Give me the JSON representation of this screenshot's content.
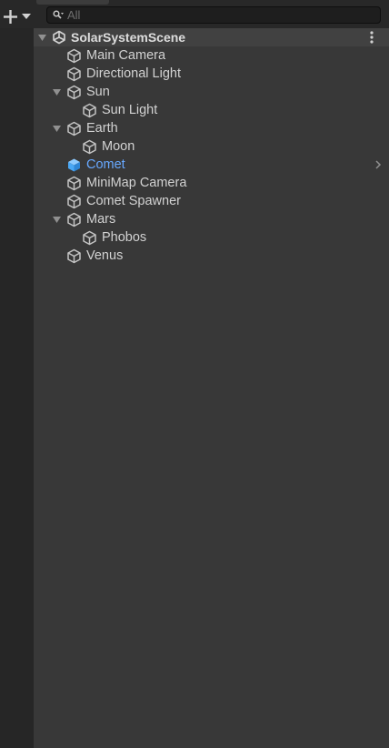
{
  "toolbar": {
    "add_icon": "plus-icon",
    "dropdown_icon": "triangle-down-icon"
  },
  "search": {
    "placeholder": "All",
    "value": "",
    "icon": "search-icon"
  },
  "scene": {
    "name": "SolarSystemScene",
    "icon": "unity-scene-icon",
    "menu_icon": "kebab-menu-icon",
    "expanded": true
  },
  "hierarchy": {
    "items": [
      {
        "label": "Main Camera",
        "depth": 0,
        "has_children": false,
        "expanded": false,
        "selected": false
      },
      {
        "label": "Directional Light",
        "depth": 0,
        "has_children": false,
        "expanded": false,
        "selected": false
      },
      {
        "label": "Sun",
        "depth": 0,
        "has_children": true,
        "expanded": true,
        "selected": false
      },
      {
        "label": "Sun Light",
        "depth": 1,
        "has_children": false,
        "expanded": false,
        "selected": false
      },
      {
        "label": "Earth",
        "depth": 0,
        "has_children": true,
        "expanded": true,
        "selected": false
      },
      {
        "label": "Moon",
        "depth": 1,
        "has_children": false,
        "expanded": false,
        "selected": false
      },
      {
        "label": "Comet",
        "depth": 0,
        "has_children": false,
        "expanded": false,
        "selected": true
      },
      {
        "label": "MiniMap Camera",
        "depth": 0,
        "has_children": false,
        "expanded": false,
        "selected": false
      },
      {
        "label": "Comet Spawner",
        "depth": 0,
        "has_children": false,
        "expanded": false,
        "selected": false
      },
      {
        "label": "Mars",
        "depth": 0,
        "has_children": true,
        "expanded": true,
        "selected": false
      },
      {
        "label": "Phobos",
        "depth": 1,
        "has_children": false,
        "expanded": false,
        "selected": false
      },
      {
        "label": "Venus",
        "depth": 0,
        "has_children": false,
        "expanded": false,
        "selected": false
      }
    ],
    "item_icon": "gameobject-cube-icon"
  },
  "colors": {
    "panel_bg": "#383838",
    "toolbar_bg": "#282828",
    "sidebar_bg": "#262626",
    "scene_header_bg": "#414141",
    "text": "#d2d2d2",
    "selected_text": "#67a8ff",
    "selected_icon": "#4aa8f5"
  }
}
